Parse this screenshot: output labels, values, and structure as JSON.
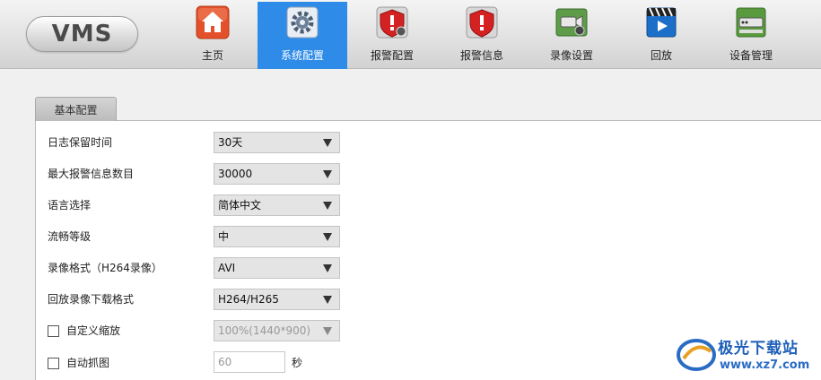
{
  "app": {
    "logo_text": "VMS"
  },
  "nav": {
    "items": [
      {
        "label": "主页",
        "icon": "home-icon"
      },
      {
        "label": "系统配置",
        "icon": "gear-icon",
        "active": true
      },
      {
        "label": "报警配置",
        "icon": "alarm-config-icon"
      },
      {
        "label": "报警信息",
        "icon": "alarm-info-icon"
      },
      {
        "label": "录像设置",
        "icon": "record-settings-icon"
      },
      {
        "label": "回放",
        "icon": "playback-icon"
      },
      {
        "label": "设备管理",
        "icon": "device-manage-icon"
      }
    ]
  },
  "tab": {
    "label": "基本配置"
  },
  "form": {
    "log_retention": {
      "label": "日志保留时间",
      "value": "30天"
    },
    "max_alarm": {
      "label": "最大报警信息数目",
      "value": "30000"
    },
    "language": {
      "label": "语言选择",
      "value": "简体中文"
    },
    "fluency": {
      "label": "流畅等级",
      "value": "中"
    },
    "record_format": {
      "label": "录像格式（H264录像）",
      "value": "AVI"
    },
    "playback_download": {
      "label": "回放录像下载格式",
      "value": "H264/H265"
    },
    "custom_zoom": {
      "label": "自定义缩放",
      "value": "100%(1440*900)",
      "checked": false
    },
    "auto_capture": {
      "label": "自动抓图",
      "value": "60",
      "unit": "秒",
      "checked": false
    }
  },
  "watermark": {
    "text": "极光下载站",
    "url": "www.xz7.com"
  },
  "colors": {
    "active_nav": "#2e8be8",
    "panel_bg": "#ffffff",
    "page_bg": "#f0f0f0"
  }
}
